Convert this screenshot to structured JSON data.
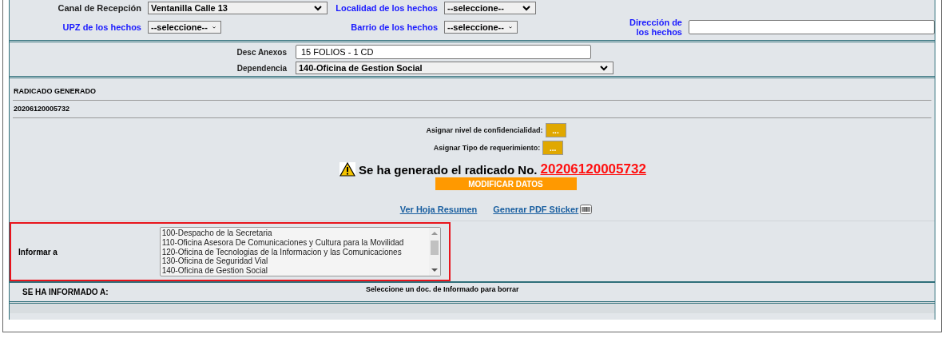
{
  "top_fields": [
    {
      "label": "Canal de Recepción",
      "highlighted": false,
      "kind": "select",
      "value": "Ventanilla Calle 13"
    },
    {
      "label": "Localidad de los hechos",
      "highlighted": true,
      "kind": "select",
      "value": "--seleccione--"
    },
    {
      "label": "UPZ de los hechos",
      "highlighted": true,
      "kind": "select",
      "value": "--seleccione--"
    },
    {
      "label": "Barrio de los hechos",
      "highlighted": true,
      "kind": "select",
      "value": "--seleccione--"
    },
    {
      "label": "Dirección de los hechos",
      "highlighted": true,
      "kind": "text"
    }
  ],
  "anexos": {
    "label": "Desc Anexos",
    "value": "15 FOLIOS - 1 CD"
  },
  "dependencia": {
    "label": "Dependencia",
    "value": "140-Oficina de Gestion Social"
  },
  "radicado": {
    "heading": "RADICADO GENERADO",
    "number": "20206120005732"
  },
  "assign": [
    {
      "label": "Asignar nivel de confidencialidad:",
      "button": "..."
    },
    {
      "label": "Asignar Tipo de requerimiento:",
      "button": "..."
    }
  ],
  "message": {
    "text": "Se ha generado el radicado No.",
    "number": "20206120005732"
  },
  "modify_button": "MODIFICAR DATOS",
  "links": [
    "Ver Hoja Resumen",
    "Generar PDF Sticker"
  ],
  "informar": {
    "label": "Informar a",
    "highlighted": true,
    "options": [
      {
        "text": "100-Despacho de la Secretaria",
        "selected": false
      },
      {
        "text": "110-Oficina Asesora De Comunicaciones y Cultura para la Movilidad",
        "selected": false
      },
      {
        "text": "120-Oficina de Tecnologias de la Informacion y las Comunicaciones",
        "selected": false
      },
      {
        "text": "130-Oficina de Seguridad Vial",
        "selected": false
      },
      {
        "text": "140-Oficina de Gestion Social",
        "selected": false
      }
    ]
  },
  "informados": {
    "label": "SE HA INFORMADO A:",
    "hint": "Seleccione un doc. de Informado para borrar"
  }
}
